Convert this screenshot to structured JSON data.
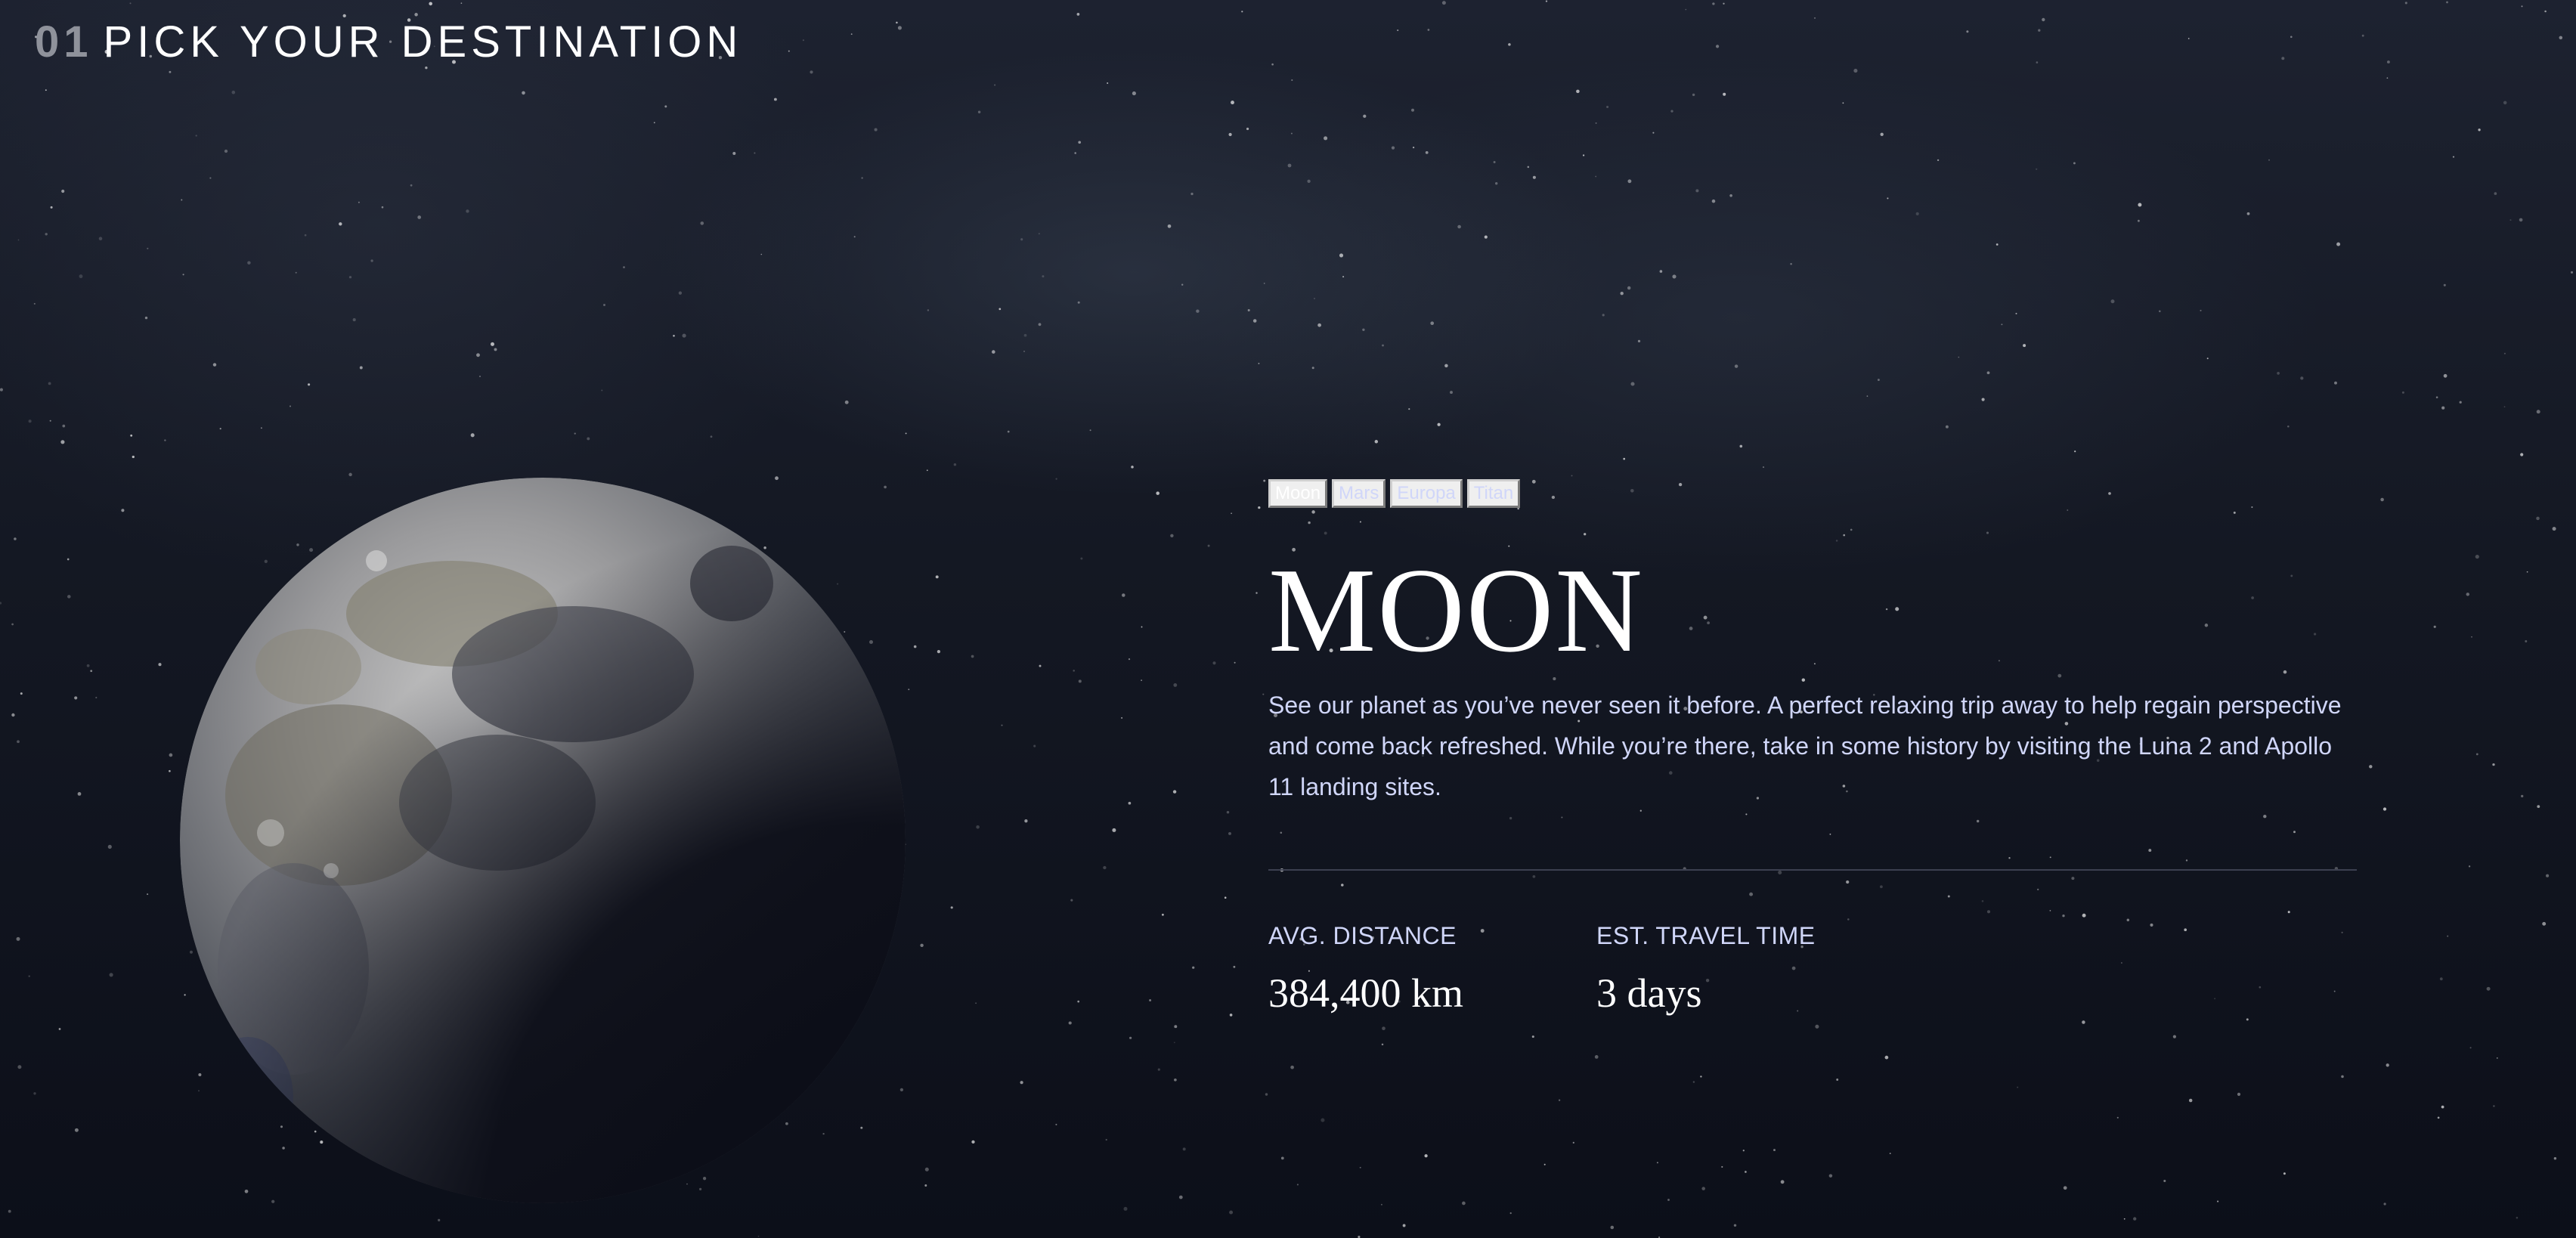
{
  "header": {
    "number": "01",
    "title": "PICK YOUR DESTINATION"
  },
  "tabs": [
    {
      "label": "Moon",
      "active": true
    },
    {
      "label": "Mars",
      "active": false
    },
    {
      "label": "Europa",
      "active": false
    },
    {
      "label": "Titan",
      "active": false
    }
  ],
  "destination": {
    "name": "MOON",
    "description": "See our planet as you’ve never seen it before. A perfect relaxing trip away to help regain perspective and come back refreshed. While you’re there, take in some history by visiting the Luna 2 and Apollo 11 landing sites.",
    "distance_label": "AVG. DISTANCE",
    "distance_value": "384,400 km",
    "travel_label": "EST. TRAVEL TIME",
    "travel_value": "3 days"
  },
  "colors": {
    "background": "#0b0d17",
    "accent_text": "#d0d6f9",
    "heading_number": "#8f929b",
    "white": "#ffffff"
  }
}
